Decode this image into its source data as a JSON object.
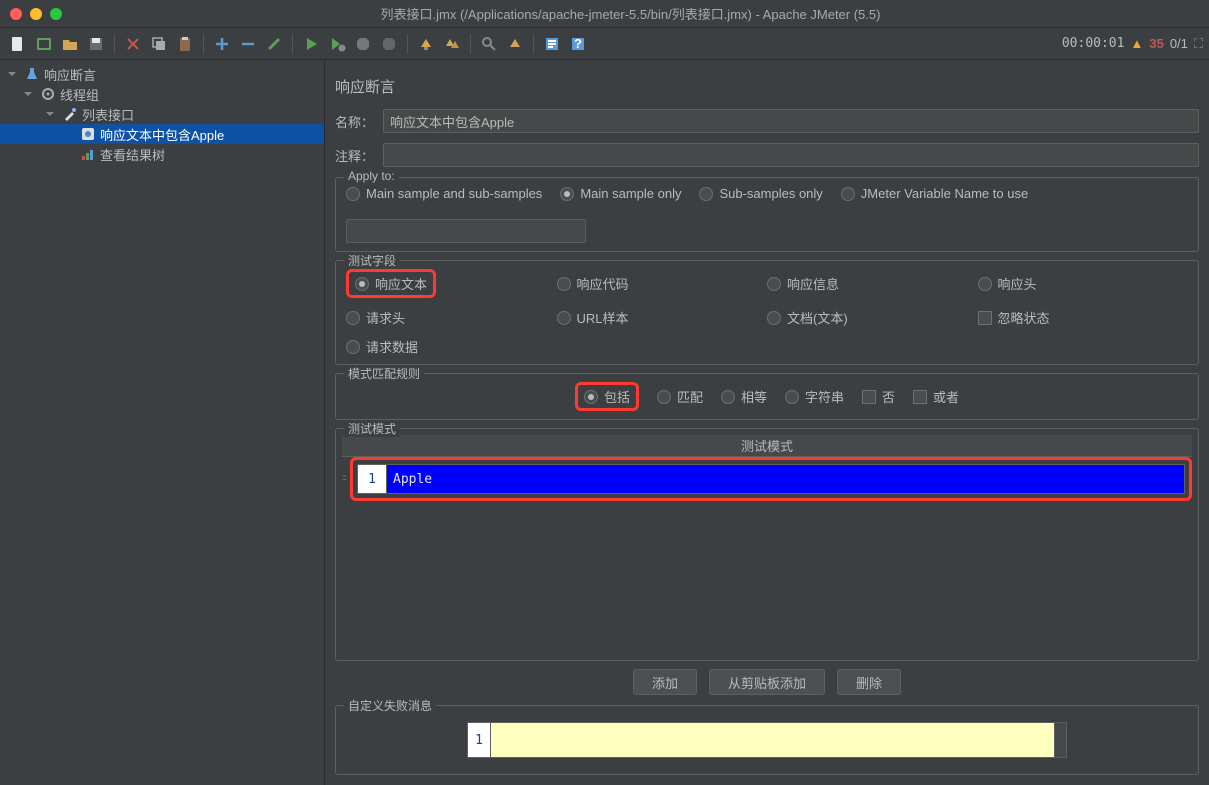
{
  "window": {
    "title": "列表接口.jmx (/Applications/apache-jmeter-5.5/bin/列表接口.jmx) - Apache JMeter (5.5)"
  },
  "status": {
    "timer": "00:00:01",
    "errors": "35",
    "ratio": "0/1"
  },
  "tree": {
    "n0": "响应断言",
    "n1": "线程组",
    "n2": "列表接口",
    "n3": "响应文本中包含Apple",
    "n4": "查看结果树"
  },
  "panel": {
    "heading": "响应断言"
  },
  "labels": {
    "name": "名称：",
    "comment": "注释："
  },
  "values": {
    "name": "响应文本中包含Apple",
    "comment": ""
  },
  "apply": {
    "legend": "Apply to:",
    "opt1": "Main sample and sub-samples",
    "opt2": "Main sample only",
    "opt3": "Sub-samples only",
    "opt4": "JMeter Variable Name to use"
  },
  "fields": {
    "legend": "测试字段",
    "resp_text": "响应文本",
    "resp_code": "响应代码",
    "resp_msg": "响应信息",
    "resp_hdr": "响应头",
    "req_hdr": "请求头",
    "url": "URL样本",
    "doc": "文档(文本)",
    "ignore": "忽略状态",
    "req_data": "请求数据"
  },
  "rules": {
    "legend": "模式匹配规则",
    "contains": "包括",
    "match": "匹配",
    "equals": "相等",
    "substr": "字符串",
    "not": "否",
    "or": "或者"
  },
  "patterns": {
    "legend": "测试模式",
    "header": "测试模式",
    "row1": "1",
    "val1": "Apple"
  },
  "buttons": {
    "add": "添加",
    "paste": "从剪贴板添加",
    "delete": "删除"
  },
  "fail": {
    "legend": "自定义失败消息",
    "row1": "1"
  }
}
